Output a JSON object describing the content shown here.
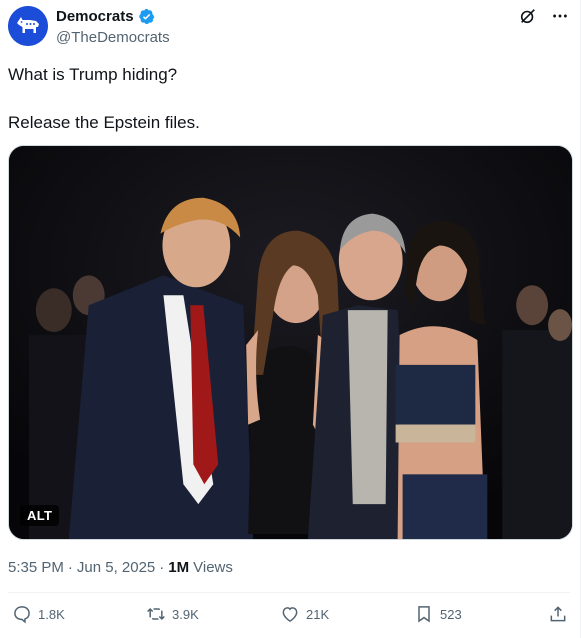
{
  "author": {
    "display_name": "Democrats",
    "handle": "@TheDemocrats",
    "verified": true,
    "avatar_icon": "donkey-logo-icon",
    "avatar_color": "#1b4dd8"
  },
  "header_icons": [
    "grok-icon",
    "more-icon"
  ],
  "tweet": {
    "line1": "What is Trump hiding?",
    "line2": "Release the Epstein files."
  },
  "media": {
    "alt_badge": "ALT"
  },
  "meta": {
    "time": "5:35 PM",
    "sep1": "·",
    "date": "Jun 5, 2025",
    "sep2": "·",
    "views_count": "1M",
    "views_label": "Views"
  },
  "actions": {
    "replies": "1.8K",
    "reposts": "3.9K",
    "likes": "21K",
    "bookmarks": "523"
  },
  "colors": {
    "text_primary": "#0f1419",
    "text_secondary": "#536471",
    "verified": "#1d9bf0",
    "divider": "#eff3f4"
  }
}
